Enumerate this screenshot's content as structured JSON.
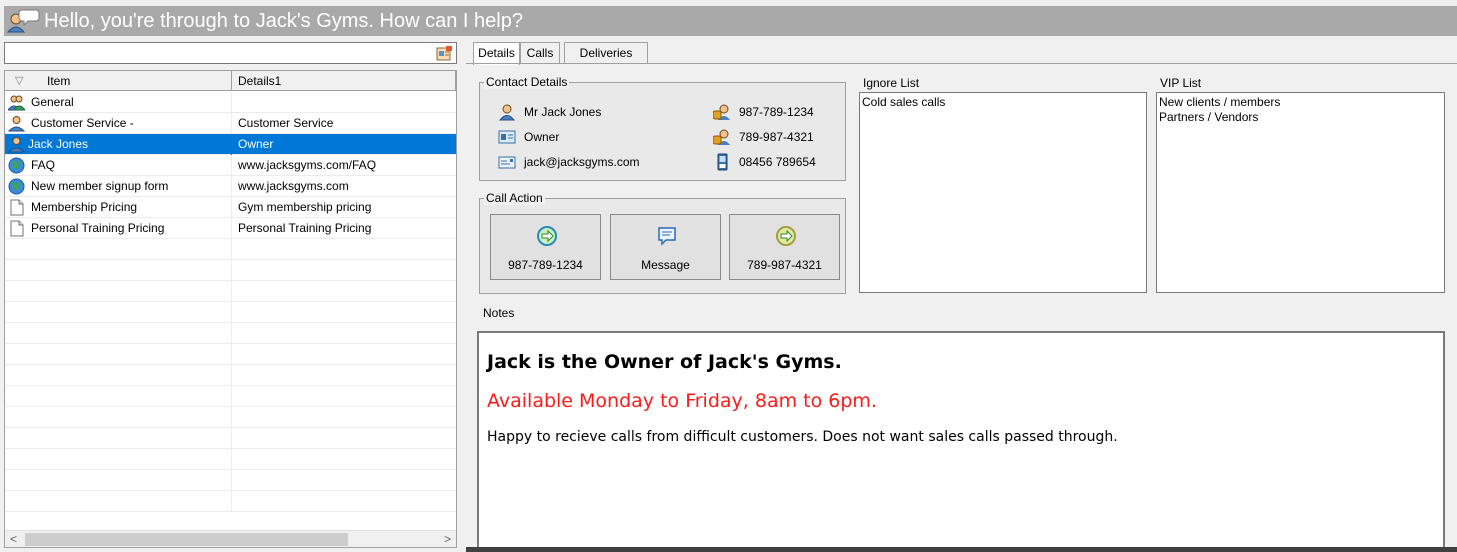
{
  "window": {
    "title": "Hello, you're through to Jack's Gyms. How can I help?"
  },
  "search": {
    "value": "",
    "placeholder": ""
  },
  "grid": {
    "columns": [
      "Item",
      "Details1"
    ],
    "rows": [
      {
        "icon": "group-icon",
        "item": "General",
        "details": ""
      },
      {
        "icon": "person-icon",
        "item": "Customer Service -",
        "details": "Customer Service"
      },
      {
        "icon": "person-icon",
        "item": "Jack Jones",
        "details": "Owner",
        "selected": true
      },
      {
        "icon": "globe-icon",
        "item": "FAQ",
        "details": "www.jacksgyms.com/FAQ"
      },
      {
        "icon": "globe-icon",
        "item": "New member signup form",
        "details": "www.jacksgyms.com"
      },
      {
        "icon": "document-icon",
        "item": "Membership Pricing",
        "details": "Gym membership pricing"
      },
      {
        "icon": "document-icon",
        "item": "Personal Training Pricing",
        "details": "Personal Training Pricing"
      }
    ],
    "empty_rows": 13,
    "scroll_left": "<",
    "scroll_right": ">"
  },
  "tabs": [
    "Details",
    "Calls",
    "Deliveries"
  ],
  "contact": {
    "legend": "Contact Details",
    "name": "Mr Jack Jones",
    "role": "Owner",
    "email": "jack@jacksgyms.com",
    "phone1": "987-789-1234",
    "phone2": "789-987-4321",
    "phone3": "08456 789654"
  },
  "call_action": {
    "legend": "Call Action",
    "buttons": [
      "987-789-1234",
      "Message",
      "789-987-4321"
    ]
  },
  "ignore_list": {
    "label": "Ignore List",
    "items": [
      "Cold sales calls"
    ]
  },
  "vip_list": {
    "label": "VIP List",
    "items": [
      "New clients / members",
      "Partners / Vendors"
    ]
  },
  "notes": {
    "label": "Notes",
    "line1": "Jack is the Owner of Jack's Gyms.",
    "line2": "Available Monday to Friday, 8am to 6pm.",
    "line3": "Happy to recieve calls from difficult customers. Does not want sales calls passed through."
  },
  "colors": {
    "selection": "#0078d7",
    "title_bar": "#a9a9a9",
    "notes_highlight": "#ff1a1a"
  }
}
